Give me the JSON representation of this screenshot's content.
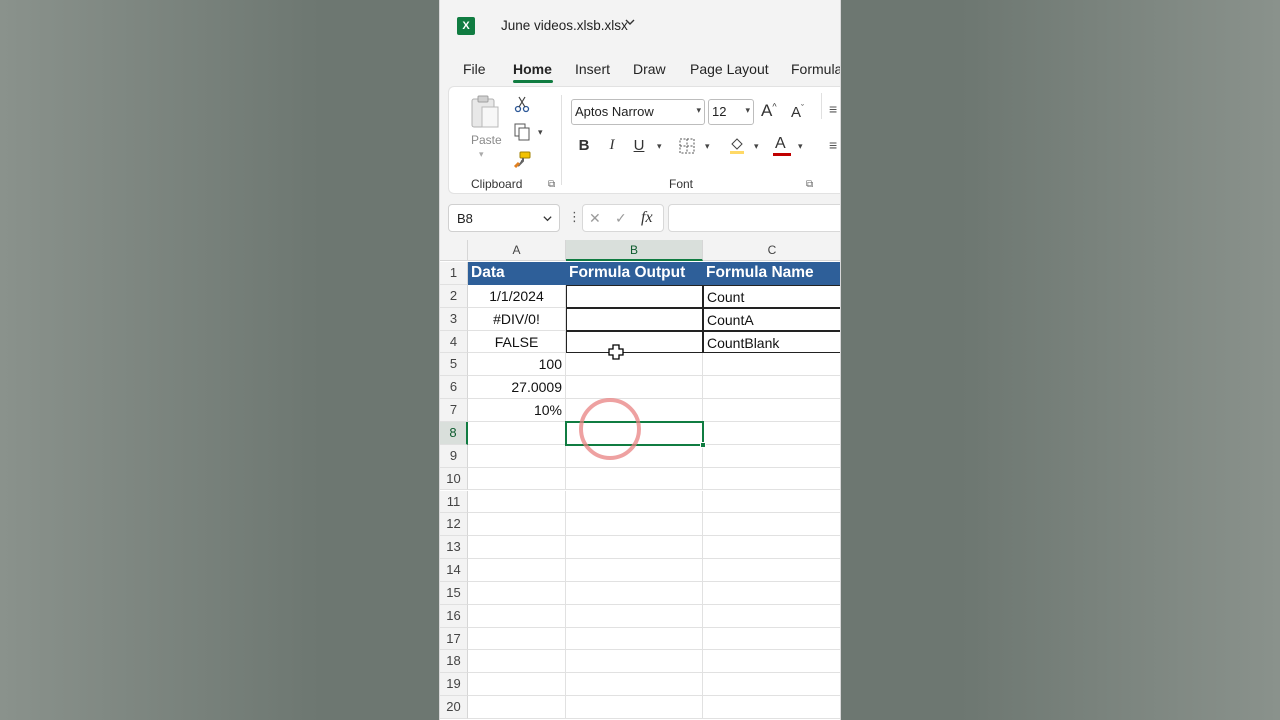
{
  "window": {
    "file_title": "June videos.xlsb.xlsx",
    "app_icon": "excel-icon",
    "title_chevron": "⌄"
  },
  "tabs": [
    {
      "label": "File",
      "active": false
    },
    {
      "label": "Home",
      "active": true
    },
    {
      "label": "Insert",
      "active": false
    },
    {
      "label": "Draw",
      "active": false
    },
    {
      "label": "Page Layout",
      "active": false
    },
    {
      "label": "Formula",
      "active": false
    }
  ],
  "ribbon": {
    "clipboard": {
      "paste_label": "Paste",
      "group_label": "Clipboard"
    },
    "font": {
      "font_name": "Aptos Narrow",
      "font_size": "12",
      "grow_label": "A",
      "shrink_label": "A",
      "bold_label": "B",
      "italic_label": "I",
      "underline_label": "U",
      "font_color_label": "A",
      "group_label": "Font",
      "font_color": "#c00000",
      "fill_color": "#ffd966"
    }
  },
  "formula_bar": {
    "name_box": "B8",
    "dots": "⋮",
    "cancel": "✕",
    "enter": "✓",
    "fx": "fx",
    "value": ""
  },
  "grid": {
    "columns": [
      "A",
      "B",
      "C"
    ],
    "selected_column": "B",
    "rows": [
      "1",
      "2",
      "3",
      "4",
      "5",
      "6",
      "7",
      "8",
      "9",
      "10",
      "11",
      "12",
      "13",
      "14",
      "15",
      "16",
      "17",
      "18",
      "19",
      "20"
    ],
    "selected_row": "8",
    "header_row": [
      "Data",
      "Formula Output",
      "Formula Name"
    ],
    "header_color": "#2e5f99",
    "data": [
      {
        "a": "1/1/2024",
        "b": "",
        "c": "Count"
      },
      {
        "a": "#DIV/0!",
        "b": "",
        "c": "CountA"
      },
      {
        "a": "FALSE",
        "b": "",
        "c": "CountBlank"
      },
      {
        "a": "100",
        "b": "",
        "c": ""
      },
      {
        "a": "27.0009",
        "b": "",
        "c": ""
      },
      {
        "a": "10%",
        "b": "",
        "c": ""
      }
    ],
    "active_cell": "B8"
  }
}
